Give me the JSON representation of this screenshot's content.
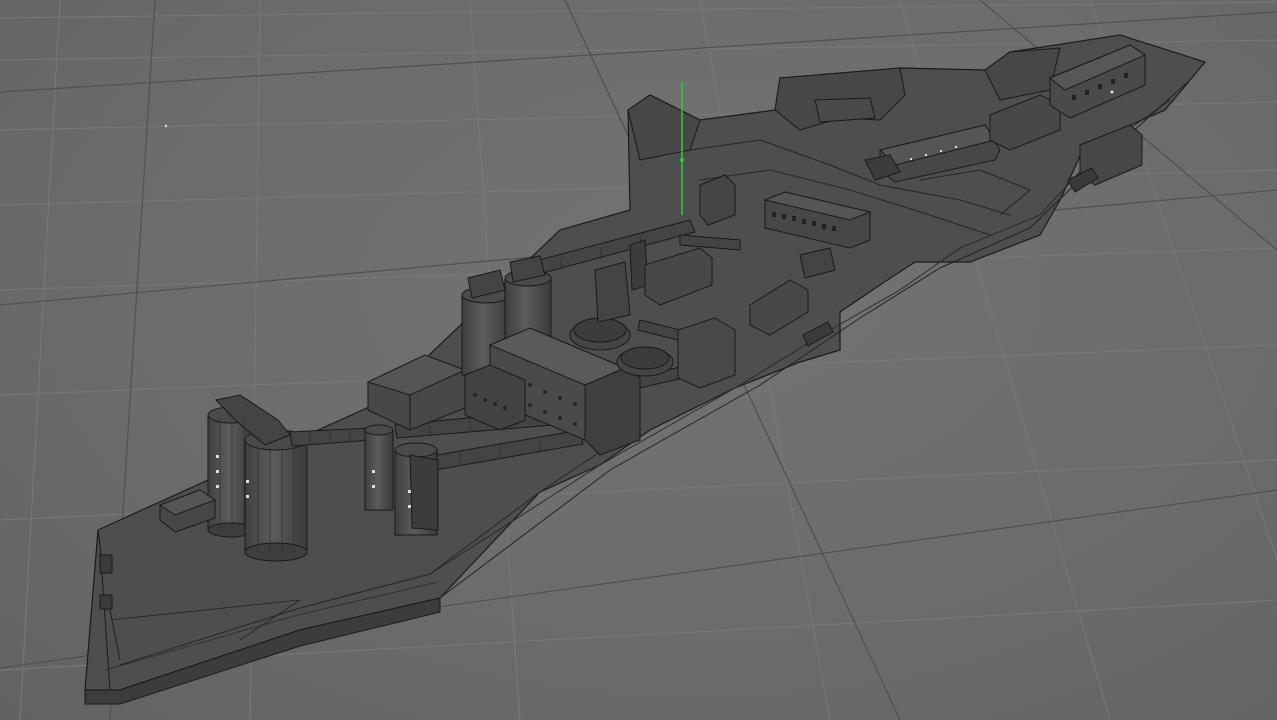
{
  "viewport": {
    "view": "perspective",
    "shading": "wireframe-on-shaded",
    "grid": true
  },
  "colors": {
    "background": "#6c6c6c",
    "grid_minor": "#7a7a7a",
    "grid_major": "#4a4a4a",
    "model_fill": "#505050",
    "model_dark": "#404040",
    "wire": "#1a1a1a",
    "pivot_axis": "#2ecc40"
  },
  "scene": {
    "model": "industrial-plant-site",
    "objects": [
      "site-platform",
      "retaining-wall",
      "silo-group-front",
      "silo-pair-middle",
      "small-silos",
      "main-factory-building",
      "conveyor-bridges",
      "thickener-tanks",
      "storage-block",
      "office-buildings",
      "parked-truck"
    ]
  },
  "pivot": {
    "icon": "move-pivot-icon"
  }
}
